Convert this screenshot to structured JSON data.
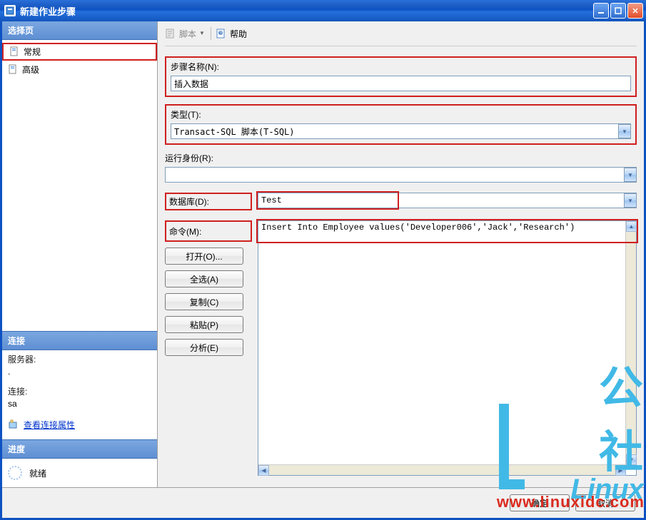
{
  "window": {
    "title": "新建作业步骤"
  },
  "left": {
    "select_page_header": "选择页",
    "nav_general": "常规",
    "nav_advanced": "高级",
    "connect_header": "连接",
    "server_label": "服务器:",
    "server_value": ".",
    "connect_label": "连接:",
    "connect_value": "sa",
    "view_props": "查看连接属性",
    "progress_header": "进度",
    "status": "就绪"
  },
  "toolbar": {
    "script": "脚本",
    "help": "帮助"
  },
  "form": {
    "step_name_label": "步骤名称(N):",
    "step_name_value": "插入数据",
    "type_label": "类型(T):",
    "type_value": "Transact-SQL 脚本(T-SQL)",
    "run_as_label": "运行身份(R):",
    "run_as_value": "",
    "database_label": "数据库(D):",
    "database_value": "Test",
    "command_label": "命令(M):",
    "command_value": "Insert Into Employee values('Developer006','Jack','Research')"
  },
  "buttons": {
    "open": "打开(O)...",
    "select_all": "全选(A)",
    "copy": "复制(C)",
    "paste": "粘贴(P)",
    "analyze": "分析(E)",
    "ok": "确定",
    "cancel": "取消"
  },
  "watermark": {
    "text1": "公社",
    "text2": "Linux",
    "url": "www.linuxidc.com"
  }
}
